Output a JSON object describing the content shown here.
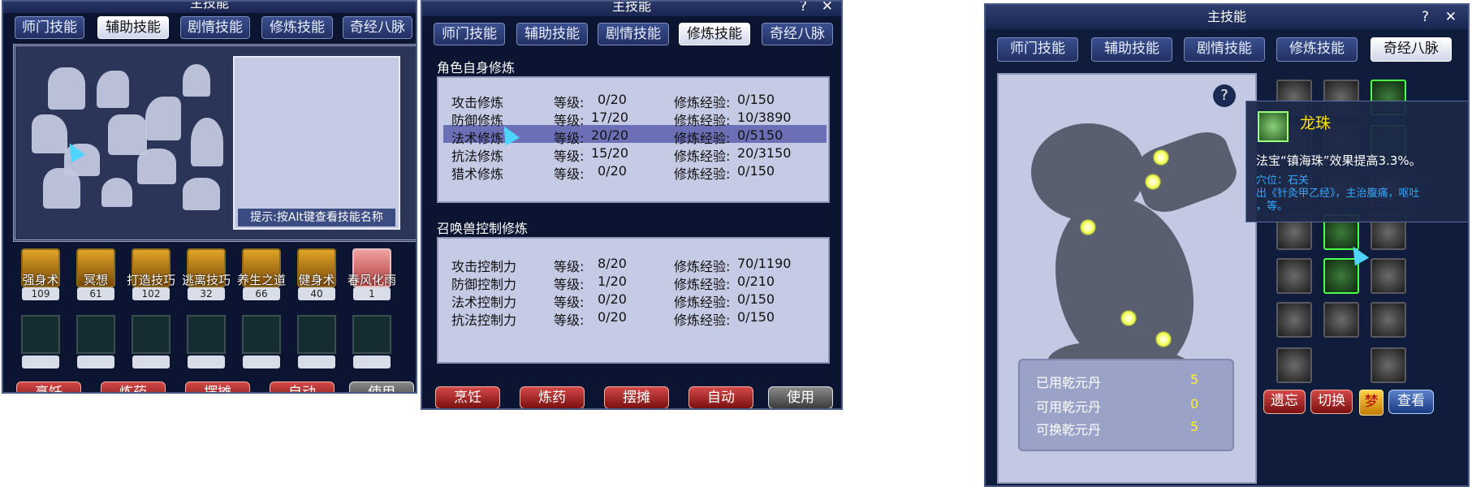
{
  "win1": {
    "title": "主技能",
    "tabs": [
      "师门技能",
      "辅助技能",
      "剧情技能",
      "修炼技能",
      "奇经八脉"
    ],
    "active_tab": 1,
    "hint": "提示:按Alt键查看技能名称",
    "skills": [
      {
        "name": "强身术",
        "level": "109"
      },
      {
        "name": "冥想",
        "level": "61"
      },
      {
        "name": "打造技巧",
        "level": "102"
      },
      {
        "name": "逃离技巧",
        "level": "32"
      },
      {
        "name": "养生之道",
        "level": "66"
      },
      {
        "name": "健身术",
        "level": "40"
      },
      {
        "name": "春风化雨",
        "level": "1"
      }
    ],
    "buttons": [
      "烹饪",
      "炼药",
      "摆摊",
      "自动",
      "使用"
    ]
  },
  "win2": {
    "title": "主技能",
    "help": "?",
    "close": "✕",
    "tabs": [
      "师门技能",
      "辅助技能",
      "剧情技能",
      "修炼技能",
      "奇经八脉"
    ],
    "active_tab": 3,
    "section1_title": "角色自身修炼",
    "section2_title": "召唤兽控制修炼",
    "self_rows": [
      {
        "name": "攻击修炼",
        "level_label": "等级:",
        "level": "0/20",
        "exp_label": "修炼经验:",
        "exp": "0/150"
      },
      {
        "name": "防御修炼",
        "level_label": "等级:",
        "level": "17/20",
        "exp_label": "修炼经验:",
        "exp": "10/3890"
      },
      {
        "name": "法术修炼",
        "level_label": "等级:",
        "level": "20/20",
        "exp_label": "修炼经验:",
        "exp": "0/5150"
      },
      {
        "name": "抗法修炼",
        "level_label": "等级:",
        "level": "15/20",
        "exp_label": "修炼经验:",
        "exp": "20/3150"
      },
      {
        "name": "猎术修炼",
        "level_label": "等级:",
        "level": "0/20",
        "exp_label": "修炼经验:",
        "exp": "0/150"
      }
    ],
    "pet_rows": [
      {
        "name": "攻击控制力",
        "level_label": "等级:",
        "level": "8/20",
        "exp_label": "修炼经验:",
        "exp": "70/1190"
      },
      {
        "name": "防御控制力",
        "level_label": "等级:",
        "level": "1/20",
        "exp_label": "修炼经验:",
        "exp": "0/210"
      },
      {
        "name": "法术控制力",
        "level_label": "等级:",
        "level": "0/20",
        "exp_label": "修炼经验:",
        "exp": "0/150"
      },
      {
        "name": "抗法控制力",
        "level_label": "等级:",
        "level": "0/20",
        "exp_label": "修炼经验:",
        "exp": "0/150"
      }
    ],
    "buttons": [
      "烹饪",
      "炼药",
      "摆摊",
      "自动",
      "使用"
    ]
  },
  "win3": {
    "title": "主技能",
    "help": "?",
    "close": "✕",
    "tabs": [
      "师门技能",
      "辅助技能",
      "剧情技能",
      "修炼技能",
      "奇经八脉"
    ],
    "active_tab": 4,
    "help_circle": "?",
    "stats": [
      {
        "label": "已用乾元丹",
        "value": "5"
      },
      {
        "label": "可用乾元丹",
        "value": "0"
      },
      {
        "label": "可换乾元丹",
        "value": "5"
      }
    ],
    "tooltip": {
      "name": "龙珠",
      "effect": "法宝“镇海珠”效果提高3.3%。",
      "acupoint": "穴位：石关",
      "source_line1": "出《针灸甲乙经》，主治腹痛，呕吐",
      "source_line2": "，等。"
    },
    "buttons": [
      "遗忘",
      "切换",
      "梦",
      "查看"
    ]
  }
}
